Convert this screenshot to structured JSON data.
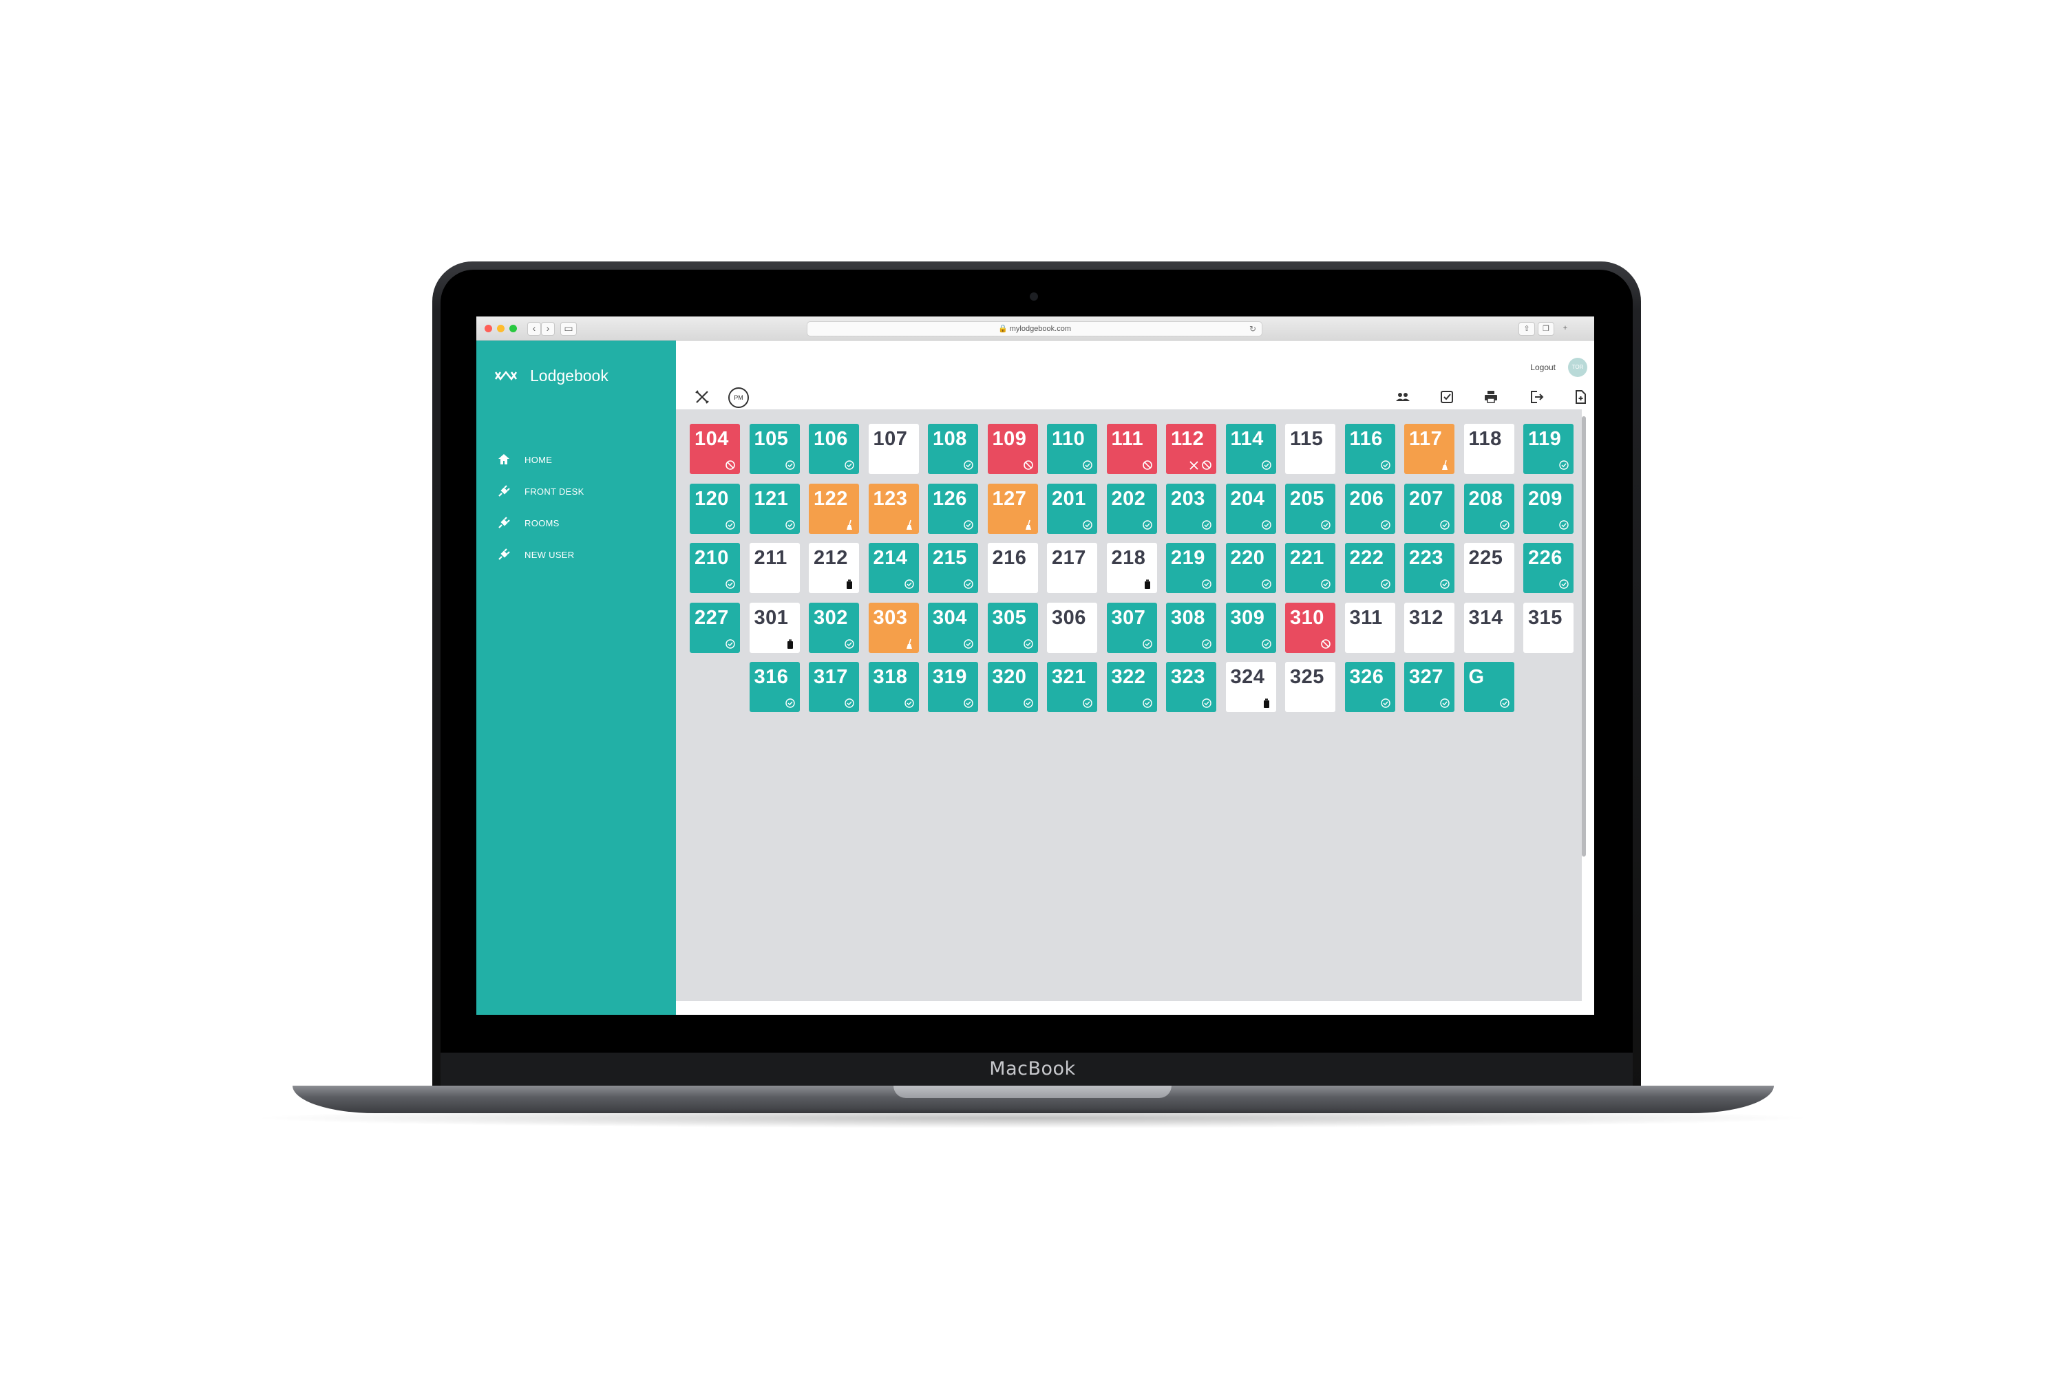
{
  "browser": {
    "url": "mylodgebook.com"
  },
  "device": {
    "label": "MacBook"
  },
  "app": {
    "name": "Lodgebook"
  },
  "sidebar": {
    "items": [
      {
        "label": "HOME",
        "icon": "home-icon"
      },
      {
        "label": "FRONT DESK",
        "icon": "plug-icon"
      },
      {
        "label": "ROOMS",
        "icon": "plug-icon"
      },
      {
        "label": "NEW USER",
        "icon": "plug-icon"
      }
    ]
  },
  "topbar": {
    "logout_label": "Logout",
    "avatar_initials": "TOR",
    "pm_label": "PM"
  },
  "colors": {
    "clean": "#20b0a6",
    "blocked": "#e94b5f",
    "service": "#f59f4a",
    "vacant": "#ffffff",
    "sidebar": "#22b0a6"
  },
  "rooms": [
    [
      {
        "number": "104",
        "status": "blocked",
        "icon": "block-icon"
      },
      {
        "number": "105",
        "status": "clean",
        "icon": "check-icon"
      },
      {
        "number": "106",
        "status": "clean",
        "icon": "check-icon"
      },
      {
        "number": "107",
        "status": "vacant",
        "icon": ""
      },
      {
        "number": "108",
        "status": "clean",
        "icon": "check-icon"
      },
      {
        "number": "109",
        "status": "blocked",
        "icon": "block-icon"
      },
      {
        "number": "110",
        "status": "clean",
        "icon": "check-icon"
      },
      {
        "number": "111",
        "status": "blocked",
        "icon": "block-icon"
      },
      {
        "number": "112",
        "status": "blocked",
        "icon": "tools-block-icon"
      },
      {
        "number": "114",
        "status": "clean",
        "icon": "check-icon"
      },
      {
        "number": "115",
        "status": "vacant",
        "icon": ""
      },
      {
        "number": "116",
        "status": "clean",
        "icon": "check-icon"
      },
      {
        "number": "117",
        "status": "service",
        "icon": "broom-icon"
      },
      {
        "number": "118",
        "status": "vacant",
        "icon": ""
      },
      {
        "number": "119",
        "status": "clean",
        "icon": "check-icon"
      }
    ],
    [
      {
        "number": "120",
        "status": "clean",
        "icon": "check-icon"
      },
      {
        "number": "121",
        "status": "clean",
        "icon": "check-icon"
      },
      {
        "number": "122",
        "status": "service",
        "icon": "broom-icon"
      },
      {
        "number": "123",
        "status": "service",
        "icon": "broom-icon"
      },
      {
        "number": "126",
        "status": "clean",
        "icon": "check-icon"
      },
      {
        "number": "127",
        "status": "service",
        "icon": "broom-icon"
      },
      {
        "number": "201",
        "status": "clean",
        "icon": "check-icon"
      },
      {
        "number": "202",
        "status": "clean",
        "icon": "check-icon"
      },
      {
        "number": "203",
        "status": "clean",
        "icon": "check-icon"
      },
      {
        "number": "204",
        "status": "clean",
        "icon": "check-icon"
      },
      {
        "number": "205",
        "status": "clean",
        "icon": "check-icon"
      },
      {
        "number": "206",
        "status": "clean",
        "icon": "check-icon"
      },
      {
        "number": "207",
        "status": "clean",
        "icon": "check-icon"
      },
      {
        "number": "208",
        "status": "clean",
        "icon": "check-icon"
      },
      {
        "number": "209",
        "status": "clean",
        "icon": "check-icon"
      }
    ],
    [
      {
        "number": "210",
        "status": "clean",
        "icon": "check-icon"
      },
      {
        "number": "211",
        "status": "vacant",
        "icon": ""
      },
      {
        "number": "212",
        "status": "vacant",
        "icon": "trash-icon"
      },
      {
        "number": "214",
        "status": "clean",
        "icon": "check-icon"
      },
      {
        "number": "215",
        "status": "clean",
        "icon": "check-icon"
      },
      {
        "number": "216",
        "status": "vacant",
        "icon": ""
      },
      {
        "number": "217",
        "status": "vacant",
        "icon": ""
      },
      {
        "number": "218",
        "status": "vacant",
        "icon": "trash-icon"
      },
      {
        "number": "219",
        "status": "clean",
        "icon": "check-icon"
      },
      {
        "number": "220",
        "status": "clean",
        "icon": "check-icon"
      },
      {
        "number": "221",
        "status": "clean",
        "icon": "check-icon"
      },
      {
        "number": "222",
        "status": "clean",
        "icon": "check-icon"
      },
      {
        "number": "223",
        "status": "clean",
        "icon": "check-icon"
      },
      {
        "number": "225",
        "status": "vacant",
        "icon": ""
      },
      {
        "number": "226",
        "status": "clean",
        "icon": "check-icon"
      }
    ],
    [
      {
        "number": "227",
        "status": "clean",
        "icon": "check-icon"
      },
      {
        "number": "301",
        "status": "vacant",
        "icon": "trash-icon"
      },
      {
        "number": "302",
        "status": "clean",
        "icon": "check-icon"
      },
      {
        "number": "303",
        "status": "service",
        "icon": "broom-icon"
      },
      {
        "number": "304",
        "status": "clean",
        "icon": "check-icon"
      },
      {
        "number": "305",
        "status": "clean",
        "icon": "check-icon"
      },
      {
        "number": "306",
        "status": "vacant",
        "icon": ""
      },
      {
        "number": "307",
        "status": "clean",
        "icon": "check-icon"
      },
      {
        "number": "308",
        "status": "clean",
        "icon": "check-icon"
      },
      {
        "number": "309",
        "status": "clean",
        "icon": "check-icon"
      },
      {
        "number": "310",
        "status": "blocked",
        "icon": "block-icon"
      },
      {
        "number": "311",
        "status": "vacant",
        "icon": ""
      },
      {
        "number": "312",
        "status": "vacant",
        "icon": ""
      },
      {
        "number": "314",
        "status": "vacant",
        "icon": ""
      },
      {
        "number": "315",
        "status": "vacant",
        "icon": ""
      }
    ],
    [
      {
        "number": "316",
        "status": "clean",
        "icon": "check-icon"
      },
      {
        "number": "317",
        "status": "clean",
        "icon": "check-icon"
      },
      {
        "number": "318",
        "status": "clean",
        "icon": "check-icon"
      },
      {
        "number": "319",
        "status": "clean",
        "icon": "check-icon"
      },
      {
        "number": "320",
        "status": "clean",
        "icon": "check-icon"
      },
      {
        "number": "321",
        "status": "clean",
        "icon": "check-icon"
      },
      {
        "number": "322",
        "status": "clean",
        "icon": "check-icon"
      },
      {
        "number": "323",
        "status": "clean",
        "icon": "check-icon"
      },
      {
        "number": "324",
        "status": "vacant",
        "icon": "trash-icon"
      },
      {
        "number": "325",
        "status": "vacant",
        "icon": ""
      },
      {
        "number": "326",
        "status": "clean",
        "icon": "check-icon"
      },
      {
        "number": "327",
        "status": "clean",
        "icon": "check-icon"
      },
      {
        "number": "G",
        "status": "clean",
        "icon": "check-icon"
      }
    ]
  ]
}
